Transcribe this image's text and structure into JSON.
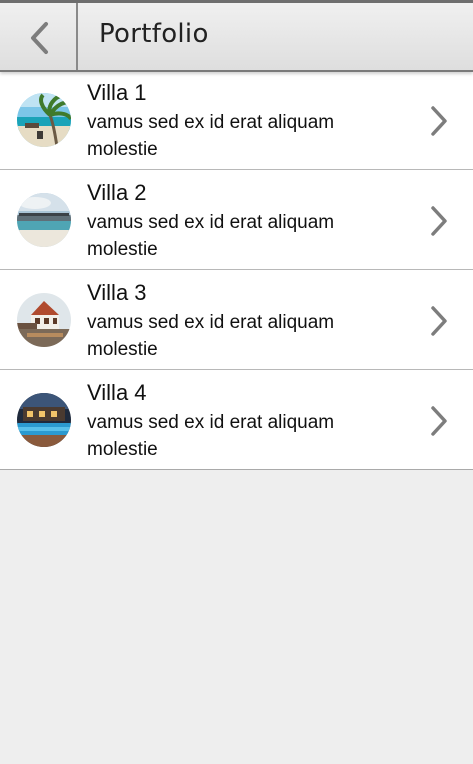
{
  "header": {
    "title": "Portfolio",
    "back_icon": "chevron-left-icon"
  },
  "items": [
    {
      "title": "Villa 1",
      "description": "vamus sed ex id erat aliquam molestie",
      "thumbnail": "beach-palm-photo"
    },
    {
      "title": "Villa 2",
      "description": "vamus sed ex id erat aliquam molestie",
      "thumbnail": "overwater-bungalow-photo"
    },
    {
      "title": "Villa 3",
      "description": "vamus sed ex id erat aliquam molestie",
      "thumbnail": "villa-house-photo"
    },
    {
      "title": "Villa 4",
      "description": "vamus sed ex id erat aliquam molestie",
      "thumbnail": "pool-night-photo"
    }
  ],
  "colors": {
    "background": "#eeeeee",
    "header_border": "#6e6e6e",
    "chevron": "#7d7d7d",
    "text": "#111111"
  }
}
